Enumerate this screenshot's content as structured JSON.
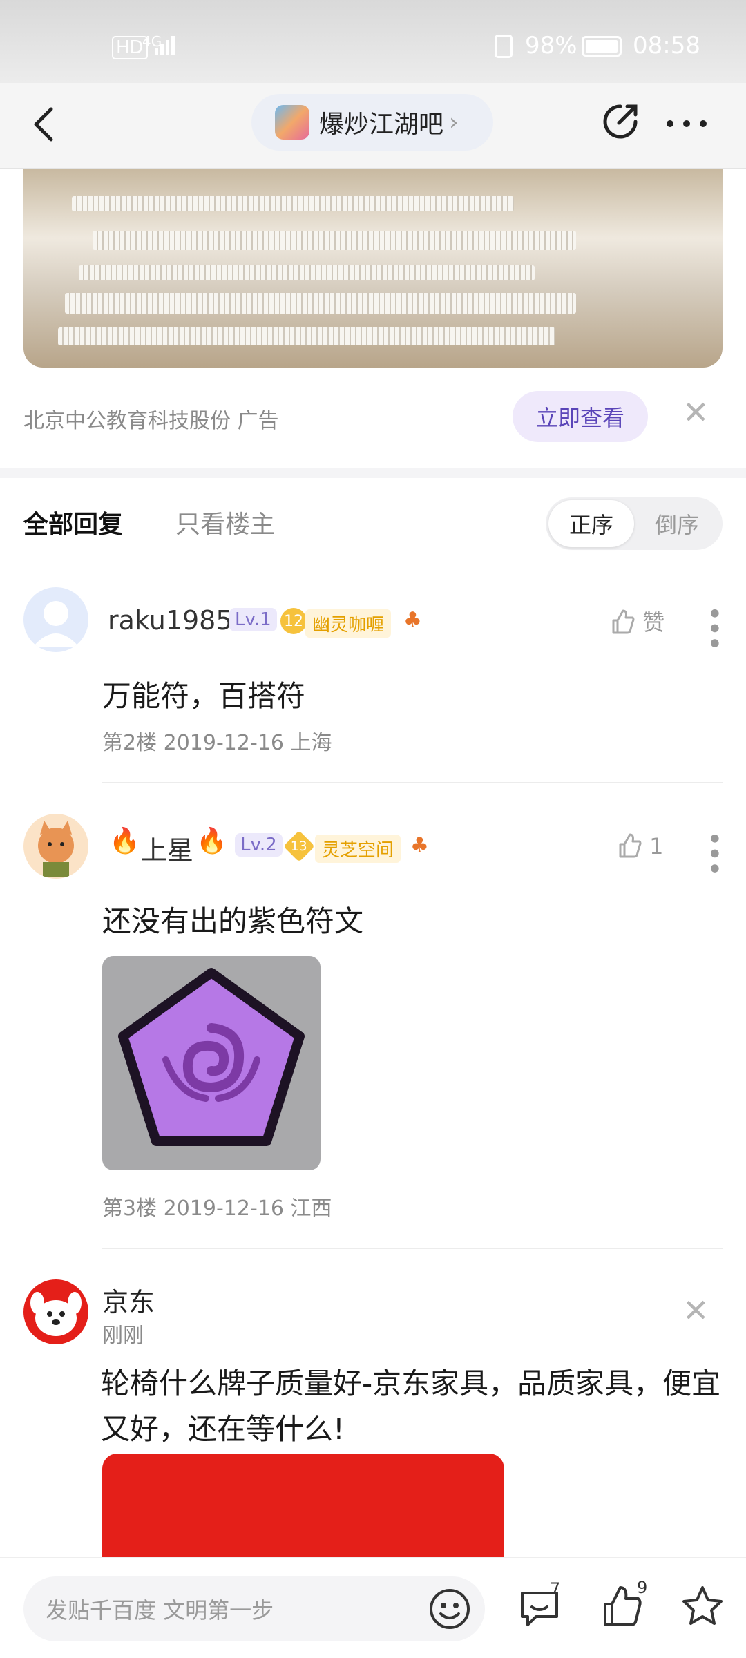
{
  "status_bar": {
    "hd": "HD",
    "network": "4G",
    "battery": "98%",
    "time": "08:58"
  },
  "header": {
    "forum_name": "爆炒江湖吧",
    "back_icon": "chevron-left-icon",
    "edit_icon": "share-edit-icon",
    "more_icon": "more-dots-icon"
  },
  "ad": {
    "source": "北京中公教育科技股份 广告",
    "cta_label": "立即查看"
  },
  "tabs": {
    "all": "全部回复",
    "op_only": "只看楼主",
    "sort_asc": "正序",
    "sort_desc": "倒序",
    "active_sort": "正序"
  },
  "posts": [
    {
      "user": "raku1985",
      "level": "Lv.1",
      "badge_level": "12",
      "badge_name": "幽灵咖喱",
      "content": "万能符，百搭符",
      "likes": "赞",
      "floor_meta": "第2楼  2019-12-16  上海"
    },
    {
      "user": "上星",
      "level": "Lv.2",
      "badge_level": "13",
      "badge_name": "灵芝空间",
      "content": "还没有出的紫色符文",
      "likes": "1",
      "floor_meta": "第3楼  2019-12-16  江西"
    }
  ],
  "sponsored": {
    "brand": "京东",
    "time": "刚刚",
    "content": "轮椅什么牌子质量好-京东家具，品质家具，便宜又好，还在等什么!"
  },
  "bottom": {
    "placeholder": "发贴千百度 文明第一步",
    "comments_count": "7",
    "likes_count": "9"
  },
  "colors": {
    "accent": "#5a45b8",
    "level_bg": "#ece9fb",
    "badge_gold": "#f6c23d",
    "jd_red": "#e41f19",
    "rune_purple": "#b678e6"
  }
}
